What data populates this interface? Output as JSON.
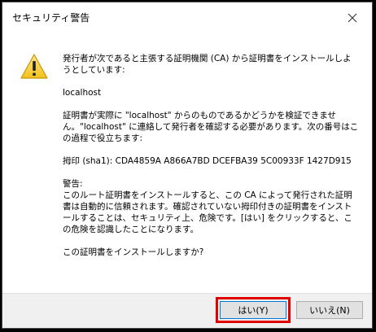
{
  "window": {
    "title": "セキュリティ警告",
    "close_icon": "close-icon"
  },
  "content": {
    "intro": "発行者が次であると主張する証明機関 (CA) から証明書をインストールしようとしています:",
    "issuer": "localhost",
    "verify_note": "証明書が実際に \"localhost\" からのものであるかどうかを検証できません。\"localhost\" に連絡して発行者を確認する必要があります。次の番号はこの過程で役立ちます:",
    "thumbprint_label": "拇印 (sha1): CDA4859A A866A7BD DCEFBA39 5C00933F 1427D915",
    "warning_heading": "警告:",
    "warning_text": "このルート証明書をインストールすると、この CA によって発行された証明書は自動的に信頼されます。確認されていない拇印付きの証明書をインストールすることは、セキュリティ上、危険です。[はい] をクリックすると、この危険を認識したことになります。",
    "question": "この証明書をインストールしますか?"
  },
  "buttons": {
    "yes_label": "はい(Y)",
    "no_label": "いいえ(N)"
  },
  "colors": {
    "highlight": "#e00000",
    "warning_yellow": "#f8d030"
  },
  "icons": {
    "warning": "warning-icon"
  }
}
